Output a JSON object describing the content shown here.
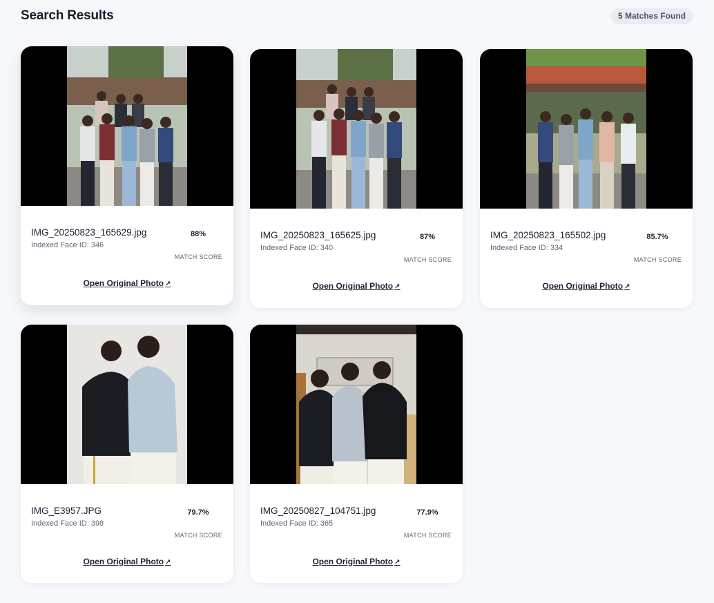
{
  "header": {
    "title": "Search Results",
    "badge": "5 Matches Found"
  },
  "score_label": "MATCH SCORE",
  "link_label": "Open Original Photo",
  "link_arrow": "↗",
  "results": [
    {
      "filename": "IMG_20250823_165629.jpg",
      "face_id": "Indexed Face ID: 346",
      "score": "88%"
    },
    {
      "filename": "IMG_20250823_165625.jpg",
      "face_id": "Indexed Face ID: 340",
      "score": "87%"
    },
    {
      "filename": "IMG_20250823_165502.jpg",
      "face_id": "Indexed Face ID: 334",
      "score": "85.7%"
    },
    {
      "filename": "IMG_E3957.JPG",
      "face_id": "Indexed Face ID: 398",
      "score": "79.7%"
    },
    {
      "filename": "IMG_20250827_104751.jpg",
      "face_id": "Indexed Face ID: 365",
      "score": "77.9%"
    }
  ]
}
